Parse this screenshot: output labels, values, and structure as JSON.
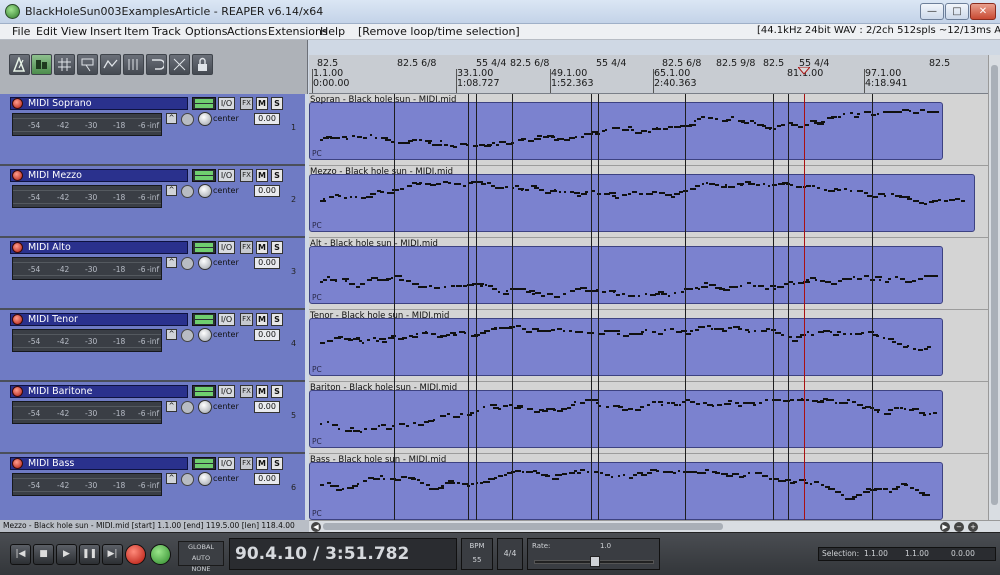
{
  "window": {
    "title": "BlackHoleSun003ExamplesArticle - REAPER v6.14/x64",
    "minimize": "—",
    "maximize": "□",
    "close": "✕"
  },
  "menu": {
    "items": [
      "File",
      "Edit",
      "View",
      "Insert",
      "Item",
      "Track",
      "Options",
      "Actions",
      "Extensions",
      "Help",
      "[Remove loop/time selection]"
    ],
    "status": "[44.1kHz 24bit WAV : 2/2ch 512spls ~12/13ms ASIO]"
  },
  "ruler": {
    "markers": [
      {
        "label": "82.5"
      },
      {
        "label": "82.5 6/8"
      },
      {
        "label": "55 4/4"
      },
      {
        "label": "82.5 6/8"
      },
      {
        "label": "55 4/4"
      },
      {
        "label": "82.5 6/8"
      },
      {
        "label": "82.5 9/8"
      },
      {
        "label": "82.5"
      },
      {
        "label": "55 4/4"
      },
      {
        "label": "82.5"
      }
    ],
    "ticks": [
      {
        "bar": "1.1.00",
        "time": "0:00.00"
      },
      {
        "bar": "33.1.00",
        "time": "1:08.727"
      },
      {
        "bar": "49.1.00",
        "time": "1:52.363"
      },
      {
        "bar": "65.1.00",
        "time": "2:40.363"
      },
      {
        "bar": "81.1.00",
        "time": ""
      },
      {
        "bar": "97.1.00",
        "time": "4:18.941"
      }
    ]
  },
  "tracks": [
    {
      "name": "MIDI  Soprano",
      "item": "Sopran - Black hole sun - MIDI.mid",
      "pan": "center",
      "vol": "0.00",
      "num": "1"
    },
    {
      "name": "MIDI  Mezzo",
      "item": "Mezzo - Black hole sun - MIDI.mid",
      "pan": "center",
      "vol": "0.00",
      "num": "2"
    },
    {
      "name": "MIDI  Alto",
      "item": "Alt - Black hole sun - MIDI.mid",
      "pan": "center",
      "vol": "0.00",
      "num": "3"
    },
    {
      "name": "MIDI  Tenor",
      "item": "Tenor - Black hole sun - MIDI.mid",
      "pan": "center",
      "vol": "0.00",
      "num": "4"
    },
    {
      "name": "MIDI  Baritone",
      "item": "Bariton - Black hole sun - MIDI.mid",
      "pan": "center",
      "vol": "0.00",
      "num": "5"
    },
    {
      "name": "MIDI  Bass",
      "item": "Bass - Black hole sun - MIDI.mid",
      "pan": "center",
      "vol": "0.00",
      "num": "6"
    }
  ],
  "track_controls": {
    "io": "I/O",
    "fx": "FX",
    "mute": "M",
    "solo": "S",
    "pc": "PC",
    "meter_scale": [
      "-54",
      "-42",
      "-30",
      "-18",
      "-6",
      "-inf"
    ]
  },
  "statusline": "Mezzo - Black hole sun - MIDI.mid [start] 1.1.00 [end] 119.5.00 [len] 118.4.00",
  "transport": {
    "position": "90.4.10 / 3:51.782",
    "bpm_label": "BPM",
    "bpm": "55",
    "time_sig": "4/4",
    "rate_label": "Rate:",
    "rate": "1.0",
    "auto_label": "GLOBAL AUTO",
    "auto_value": "NONE",
    "selection_label": "Selection:",
    "selection_start": "1.1.00",
    "selection_end": "1.1.00",
    "selection_len": "0.0.00"
  }
}
